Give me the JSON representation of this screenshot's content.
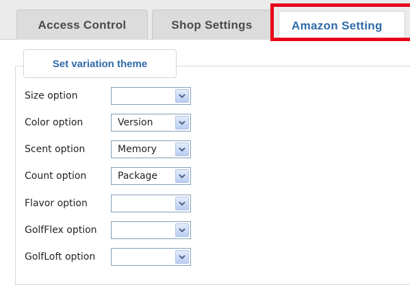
{
  "tabs": [
    {
      "label": "Access Control"
    },
    {
      "label": "Shop Settings"
    },
    {
      "label": "Amazon Setting"
    }
  ],
  "section": {
    "legend": "Set variation theme"
  },
  "options": [
    {
      "label": "Size option",
      "value": ""
    },
    {
      "label": "Color option",
      "value": "Version"
    },
    {
      "label": "Scent option",
      "value": "Memory"
    },
    {
      "label": "Count option",
      "value": "Package"
    },
    {
      "label": "Flavor option",
      "value": ""
    },
    {
      "label": "GolfFlex option",
      "value": ""
    },
    {
      "label": "GolfLoft option",
      "value": ""
    }
  ],
  "colors": {
    "active_tab_text": "#2e6aa8",
    "highlight_box": "#e8001a"
  }
}
